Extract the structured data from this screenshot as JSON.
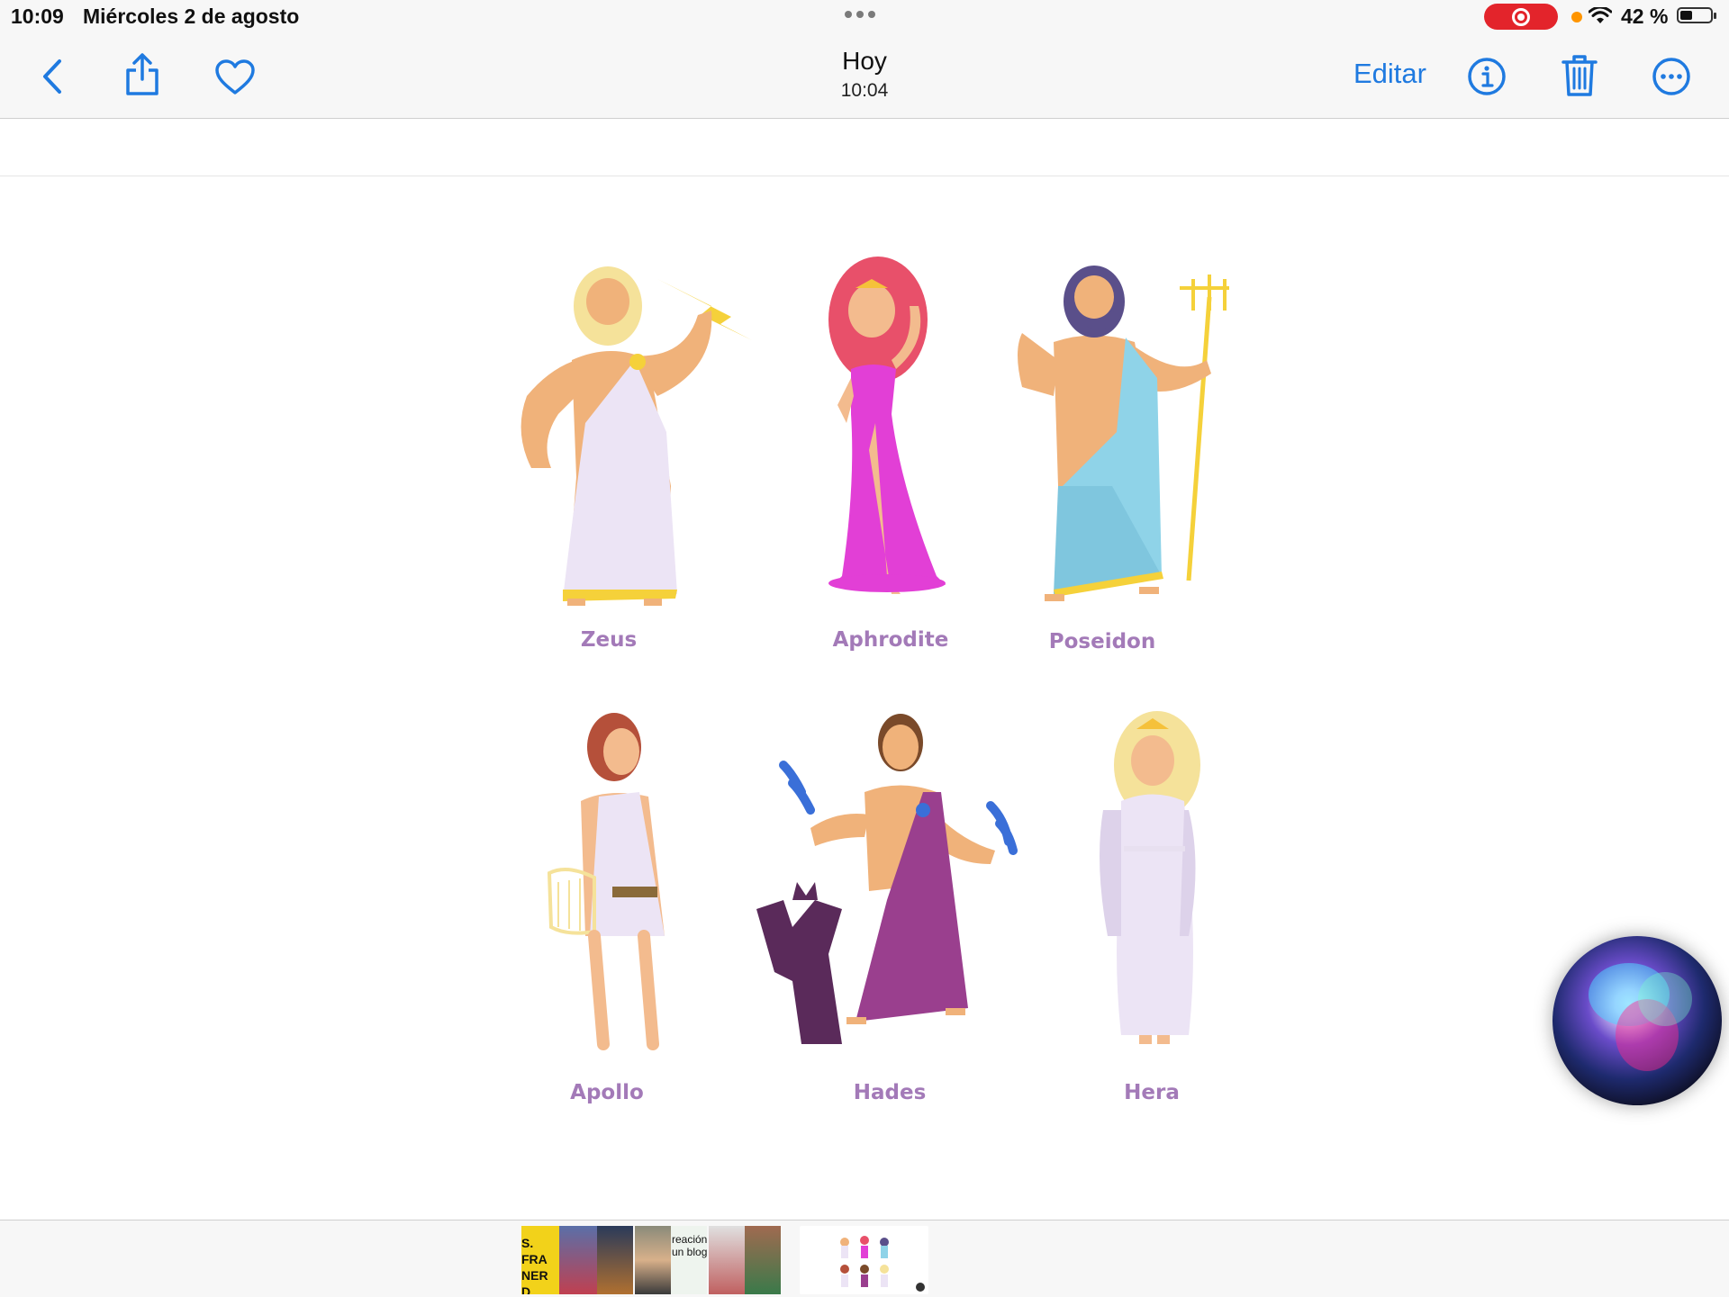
{
  "status_bar": {
    "time": "10:09",
    "date": "Miércoles 2 de agosto",
    "battery_percent": "42 %",
    "battery_level": 0.42,
    "screen_recording": true
  },
  "navbar": {
    "title": "Hoy",
    "subtitle": "10:04",
    "edit_label": "Editar",
    "accent_color": "#1f7ae0",
    "icons": [
      "back-chevron-icon",
      "share-icon",
      "heart-icon",
      "info-icon",
      "trash-icon",
      "more-icon"
    ]
  },
  "photo": {
    "characters": [
      {
        "name": "Zeus"
      },
      {
        "name": "Aphrodite"
      },
      {
        "name": "Poseidon"
      },
      {
        "name": "Apollo"
      },
      {
        "name": "Hades"
      },
      {
        "name": "Hera"
      }
    ],
    "caption_color": "#a37ab8"
  },
  "filmstrip": {
    "thumbnails": [
      {
        "text": "S. FRA NER D"
      },
      {
        "text": ""
      },
      {
        "text": ""
      },
      {
        "text": ""
      },
      {
        "text": "reación un blog"
      },
      {
        "text": ""
      },
      {
        "text": ""
      },
      {
        "text": ""
      }
    ],
    "selected_index": 7
  }
}
